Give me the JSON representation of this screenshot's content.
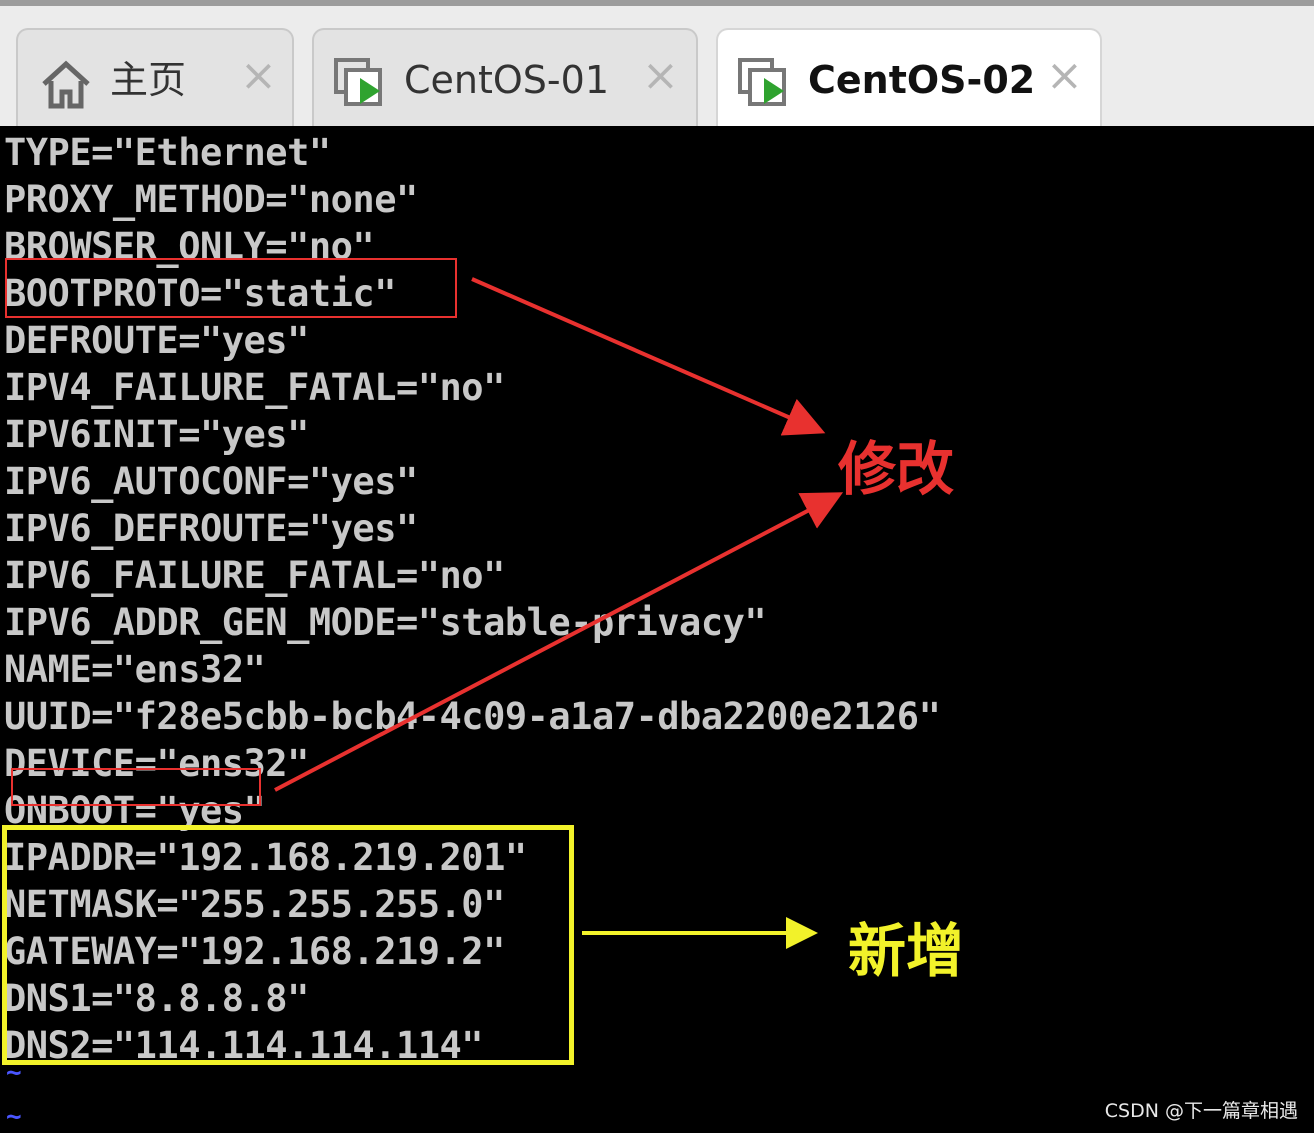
{
  "tabs": [
    {
      "label": "主页",
      "icon": "home-icon",
      "active": false
    },
    {
      "label": "CentOS-01",
      "icon": "vm-play-icon",
      "active": false
    },
    {
      "label": "CentOS-02",
      "icon": "vm-play-icon",
      "active": true
    }
  ],
  "tab_close_glyph": "×",
  "terminal": {
    "lines": [
      "TYPE=\"Ethernet\"",
      "PROXY_METHOD=\"none\"",
      "BROWSER_ONLY=\"no\"",
      "BOOTPROTO=\"static\"",
      "DEFROUTE=\"yes\"",
      "IPV4_FAILURE_FATAL=\"no\"",
      "IPV6INIT=\"yes\"",
      "IPV6_AUTOCONF=\"yes\"",
      "IPV6_DEFROUTE=\"yes\"",
      "IPV6_FAILURE_FATAL=\"no\"",
      "IPV6_ADDR_GEN_MODE=\"stable-privacy\"",
      "NAME=\"ens32\"",
      "UUID=\"f28e5cbb-bcb4-4c09-a1a7-dba2200e2126\"",
      "DEVICE=\"ens32\"",
      "ONBOOT=\"yes\"",
      "IPADDR=\"192.168.219.201\"",
      "NETMASK=\"255.255.255.0\"",
      "GATEWAY=\"192.168.219.2\"",
      "DNS1=\"8.8.8.8\"",
      "DNS2=\"114.114.114.114\""
    ],
    "tildes": [
      "~",
      "~"
    ]
  },
  "annotations": {
    "modify_label": "修改",
    "added_label": "新增",
    "modify_color": "#e8312f",
    "added_color": "#f2f22a"
  },
  "watermark": "CSDN @下一篇章相遇"
}
